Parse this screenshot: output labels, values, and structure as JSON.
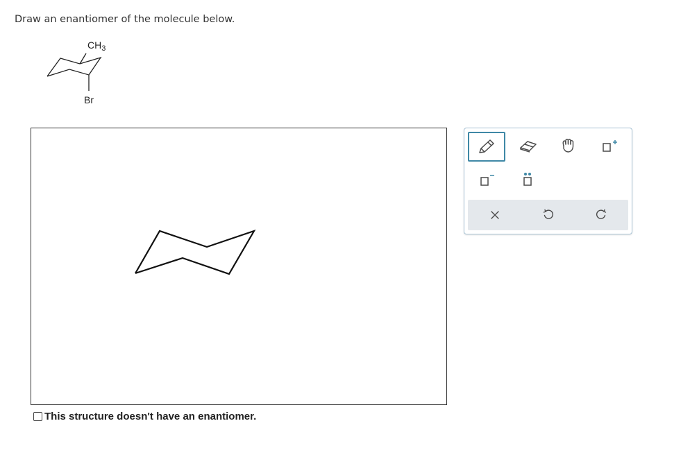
{
  "question": {
    "text": "Draw an enantiomer of the molecule below."
  },
  "given_molecule": {
    "substituent_top": "CH",
    "substituent_top_sub": "3",
    "substituent_bottom": "Br"
  },
  "option": {
    "no_enantiomer_label": "This structure doesn't have an enantiomer.",
    "checked": false
  },
  "toolbar": {
    "tools": [
      {
        "name": "pencil-icon",
        "selected": true
      },
      {
        "name": "eraser-icon"
      },
      {
        "name": "hand-icon"
      },
      {
        "name": "positive-charge-icon"
      },
      {
        "name": "negative-charge-icon"
      },
      {
        "name": "lone-pair-icon"
      }
    ],
    "actions": [
      {
        "name": "clear-icon"
      },
      {
        "name": "undo-icon"
      },
      {
        "name": "redo-icon"
      }
    ],
    "accent": "#3f88a6",
    "icon_color": "#4a4a4a"
  }
}
